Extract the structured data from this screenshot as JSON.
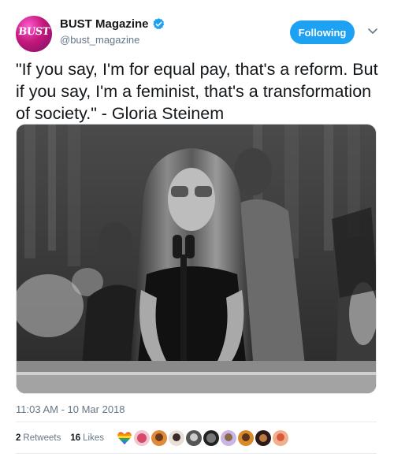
{
  "account": {
    "display_name": "BUST Magazine",
    "handle": "@bust_magazine",
    "avatar_text": "BUST"
  },
  "follow_button": {
    "label": "Following"
  },
  "tweet": {
    "text": "\"If you say, I'm for equal pay, that's a reform. But if you say, I'm a feminist, that's a transformation of society.\" - Gloria Steinem",
    "timestamp": "11:03 AM - 10 Mar 2018"
  },
  "stats": {
    "retweets_count": "2",
    "retweets_label": "Retweets",
    "likes_count": "16",
    "likes_label": "Likes"
  },
  "colors": {
    "accent": "#1da1f2",
    "muted_text": "#657786"
  },
  "icons": [
    "verified-icon",
    "chevron-down-icon",
    "rainbow-heart-icon"
  ]
}
